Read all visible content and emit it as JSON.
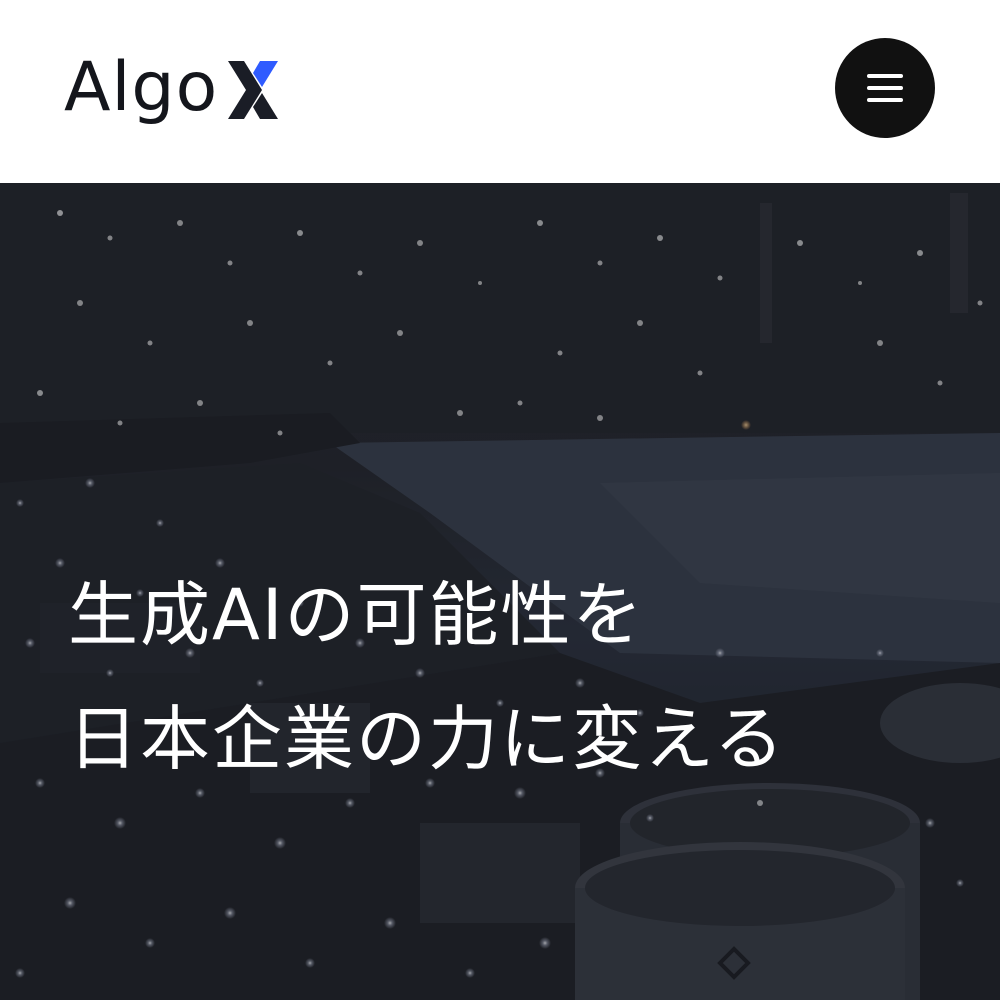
{
  "header": {
    "logo_text": "Algo",
    "logo_mark": "X",
    "menu_icon": "hamburger-menu-icon"
  },
  "hero": {
    "headline_line1": "生成AIの可能性を",
    "headline_line2": "日本企業の力に変える",
    "background": "night-industrial-cityscape"
  },
  "colors": {
    "header_bg": "#ffffff",
    "logo_text": "#14161c",
    "logo_x_dark": "#1a1d26",
    "logo_x_blue": "#2f5bff",
    "menu_button_bg": "#111111",
    "hero_text": "#ffffff"
  }
}
